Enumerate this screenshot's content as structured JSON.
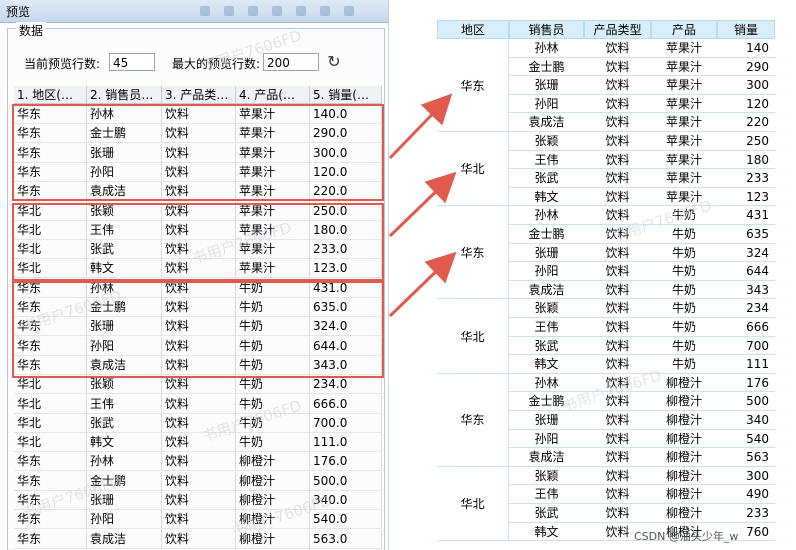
{
  "window": {
    "title": "预览",
    "panel_title": "数据",
    "current_rows_label": "当前预览行数:",
    "current_rows_value": "45",
    "max_rows_label": "最大的预览行数:",
    "max_rows_value": "200",
    "refresh_icon": "refresh-icon",
    "watermark": "书用户7606FD",
    "columns": [
      "1. 地区(…",
      "2. 销售员…",
      "3. 产品类…",
      "4. 产品(…",
      "5. 销量(…"
    ],
    "rows": [
      [
        "华东",
        "孙林",
        "饮料",
        "苹果汁",
        "140.0"
      ],
      [
        "华东",
        "金士鹏",
        "饮料",
        "苹果汁",
        "290.0"
      ],
      [
        "华东",
        "张珊",
        "饮料",
        "苹果汁",
        "300.0"
      ],
      [
        "华东",
        "孙阳",
        "饮料",
        "苹果汁",
        "120.0"
      ],
      [
        "华东",
        "袁成洁",
        "饮料",
        "苹果汁",
        "220.0"
      ],
      [
        "华北",
        "张颖",
        "饮料",
        "苹果汁",
        "250.0"
      ],
      [
        "华北",
        "王伟",
        "饮料",
        "苹果汁",
        "180.0"
      ],
      [
        "华北",
        "张武",
        "饮料",
        "苹果汁",
        "233.0"
      ],
      [
        "华北",
        "韩文",
        "饮料",
        "苹果汁",
        "123.0"
      ],
      [
        "华东",
        "孙林",
        "饮料",
        "牛奶",
        "431.0"
      ],
      [
        "华东",
        "金士鹏",
        "饮料",
        "牛奶",
        "635.0"
      ],
      [
        "华东",
        "张珊",
        "饮料",
        "牛奶",
        "324.0"
      ],
      [
        "华东",
        "孙阳",
        "饮料",
        "牛奶",
        "644.0"
      ],
      [
        "华东",
        "袁成洁",
        "饮料",
        "牛奶",
        "343.0"
      ],
      [
        "华北",
        "张颖",
        "饮料",
        "牛奶",
        "234.0"
      ],
      [
        "华北",
        "王伟",
        "饮料",
        "牛奶",
        "666.0"
      ],
      [
        "华北",
        "张武",
        "饮料",
        "牛奶",
        "700.0"
      ],
      [
        "华北",
        "韩文",
        "饮料",
        "牛奶",
        "111.0"
      ],
      [
        "华东",
        "孙林",
        "饮料",
        "柳橙汁",
        "176.0"
      ],
      [
        "华东",
        "金士鹏",
        "饮料",
        "柳橙汁",
        "500.0"
      ],
      [
        "华东",
        "张珊",
        "饮料",
        "柳橙汁",
        "340.0"
      ],
      [
        "华东",
        "孙阳",
        "饮料",
        "柳橙汁",
        "540.0"
      ],
      [
        "华东",
        "袁成洁",
        "饮料",
        "柳橙汁",
        "563.0"
      ]
    ]
  },
  "report": {
    "headers": [
      "地区",
      "销售员",
      "产品类型",
      "产品",
      "销量"
    ],
    "groups": [
      {
        "region": "华东",
        "rows": [
          [
            "孙林",
            "饮料",
            "苹果汁",
            "140"
          ],
          [
            "金士鹏",
            "饮料",
            "苹果汁",
            "290"
          ],
          [
            "张珊",
            "饮料",
            "苹果汁",
            "300"
          ],
          [
            "孙阳",
            "饮料",
            "苹果汁",
            "120"
          ],
          [
            "袁成洁",
            "饮料",
            "苹果汁",
            "220"
          ]
        ]
      },
      {
        "region": "华北",
        "rows": [
          [
            "张颖",
            "饮料",
            "苹果汁",
            "250"
          ],
          [
            "王伟",
            "饮料",
            "苹果汁",
            "180"
          ],
          [
            "张武",
            "饮料",
            "苹果汁",
            "233"
          ],
          [
            "韩文",
            "饮料",
            "苹果汁",
            "123"
          ]
        ]
      },
      {
        "region": "华东",
        "rows": [
          [
            "孙林",
            "饮料",
            "牛奶",
            "431"
          ],
          [
            "金士鹏",
            "饮料",
            "牛奶",
            "635"
          ],
          [
            "张珊",
            "饮料",
            "牛奶",
            "324"
          ],
          [
            "孙阳",
            "饮料",
            "牛奶",
            "644"
          ],
          [
            "袁成洁",
            "饮料",
            "牛奶",
            "343"
          ]
        ]
      },
      {
        "region": "华北",
        "rows": [
          [
            "张颖",
            "饮料",
            "牛奶",
            "234"
          ],
          [
            "王伟",
            "饮料",
            "牛奶",
            "666"
          ],
          [
            "张武",
            "饮料",
            "牛奶",
            "700"
          ],
          [
            "韩文",
            "饮料",
            "牛奶",
            "111"
          ]
        ]
      },
      {
        "region": "华东",
        "rows": [
          [
            "孙林",
            "饮料",
            "柳橙汁",
            "176"
          ],
          [
            "金士鹏",
            "饮料",
            "柳橙汁",
            "500"
          ],
          [
            "张珊",
            "饮料",
            "柳橙汁",
            "340"
          ],
          [
            "孙阳",
            "饮料",
            "柳橙汁",
            "540"
          ],
          [
            "袁成洁",
            "饮料",
            "柳橙汁",
            "563"
          ]
        ]
      },
      {
        "region": "华北",
        "rows": [
          [
            "张颖",
            "饮料",
            "柳橙汁",
            "300"
          ],
          [
            "王伟",
            "饮料",
            "柳橙汁",
            "490"
          ],
          [
            "张武",
            "饮料",
            "柳橙汁",
            "233"
          ],
          [
            "韩文",
            "饮料",
            "柳橙汁",
            "760"
          ]
        ]
      }
    ]
  },
  "credit": "CSDN @油头少年_w",
  "colors": {
    "highlight": "#e05a4e",
    "arrow": "#e05a4e",
    "report_header": "#d8eefb"
  }
}
